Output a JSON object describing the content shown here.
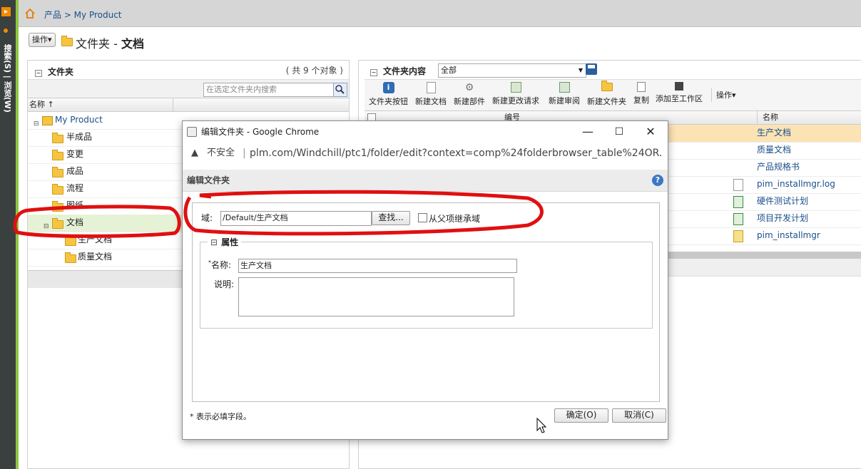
{
  "side_strip": {
    "text": "搜索(S) | 浏览(W)"
  },
  "breadcrumb": {
    "text": "产品 > My Product"
  },
  "page": {
    "actions_label": "操作▾",
    "title_prefix": "文件夹 - ",
    "title_bold": "文档"
  },
  "left_panel": {
    "title": "文件夹",
    "count": "( 共 9 个对象 )",
    "search_placeholder": "在选定文件夹内搜索",
    "column_name": "名称 ↑",
    "tree": [
      {
        "label": "My Product",
        "level": 0
      },
      {
        "label": "半成品",
        "level": 1
      },
      {
        "label": "变更",
        "level": 1
      },
      {
        "label": "成品",
        "level": 1
      },
      {
        "label": "流程",
        "level": 1
      },
      {
        "label": "图纸",
        "level": 1
      },
      {
        "label": "文档",
        "level": 1,
        "selected": true
      },
      {
        "label": "生产文档",
        "level": 2
      },
      {
        "label": "质量文档",
        "level": 2
      }
    ]
  },
  "right_panel": {
    "title": "文件夹内容",
    "filter_value": "全部",
    "toolbar": [
      {
        "label": "文件夹按钮",
        "icon": "info-icon"
      },
      {
        "label": "新建文档",
        "icon": "new-document-icon"
      },
      {
        "label": "新建部件",
        "icon": "new-part-icon"
      },
      {
        "label": "新建更改请求",
        "icon": "new-change-request-icon"
      },
      {
        "label": "新建审阅",
        "icon": "new-review-icon"
      },
      {
        "label": "新建文件夹",
        "icon": "new-folder-icon"
      },
      {
        "label": "复制",
        "icon": "copy-icon"
      },
      {
        "label": "添加至工作区",
        "icon": "add-to-workspace-icon"
      }
    ],
    "toolbar_actions": "操作▾",
    "col_number": "编号",
    "col_name": "名称",
    "rows": [
      {
        "name": "生产文档",
        "icon": "folder-icon",
        "selected": true
      },
      {
        "name": "质量文档",
        "icon": "folder-icon"
      },
      {
        "name": "产品规格书",
        "icon": "folder-icon"
      },
      {
        "name": "pim_installmgr.log",
        "icon": "text-file-icon"
      },
      {
        "name": "硬件测试计划",
        "icon": "spreadsheet-icon"
      },
      {
        "name": "项目开发计划",
        "icon": "spreadsheet-icon"
      },
      {
        "name": "pim_installmgr",
        "icon": "notepad-icon"
      }
    ]
  },
  "dialog": {
    "window_title": "编辑文件夹 - Google Chrome",
    "insecure": "不安全",
    "url": "plm.com/Windchill/ptc1/folder/edit?context=comp%24folderbrowser_table%24OR...",
    "header": "编辑文件夹",
    "domain_label": "域:",
    "domain_value": "/Default/生产文档",
    "find_button": "查找...",
    "inherit_label": "从父项继承域",
    "attributes_legend": "属性",
    "name_label": "名称:",
    "name_value": "生产文档",
    "description_label": "说明:",
    "description_value": "",
    "required_note": "* 表示必填字段。",
    "ok_button": "确定(O)",
    "cancel_button": "取消(C)"
  },
  "colors": {
    "annotation_red": "#e01010",
    "selection_green": "#e6f2d6",
    "selection_orange": "#fbe3b4"
  }
}
